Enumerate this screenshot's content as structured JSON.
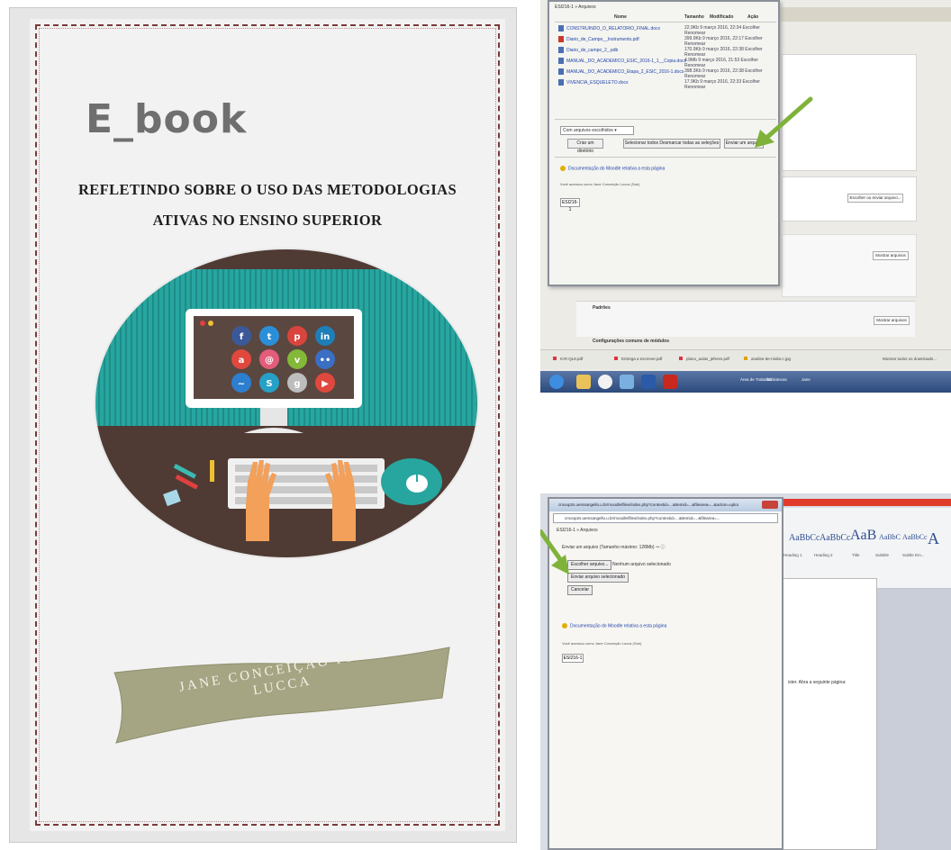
{
  "cover": {
    "title": "E_book",
    "subtitle_line1": "REFLETINDO SOBRE O USO DAS METODOLOGIAS",
    "subtitle_line2": "ATIVAS NO ENSINO SUPERIOR",
    "author_line1": "JANE CONCEIÇÃO FERR",
    "author_line2": "LUCCA"
  },
  "screenshot1": {
    "dialog_title": "ESI216-1 » Arquivos",
    "columns": {
      "name": "Nome",
      "size": "Tamanho",
      "modified": "Modificado",
      "action": "Ação"
    },
    "files": [
      {
        "name": "CONSTRUINDO_O_RELATORIO_FINAL.docx",
        "meta": "22.9Kb 9 março 2016, 22:34 Escolher Renomear"
      },
      {
        "name": "Diario_de_Campo__Instrumento.pdf",
        "meta": "399.9Kb 9 março 2016, 22:17 Escolher Renomear"
      },
      {
        "name": "Diario_de_campo_2_.pdb",
        "meta": "170.9Kb 9 março 2016, 22:38 Escolher Renomear"
      },
      {
        "name": "MANUAL_DO_ACADEMICO_ESIC_2016-1_1__Copia.docx",
        "meta": "4.9Mb 9 março 2016, 21:53 Escolher Renomear"
      },
      {
        "name": "MANUAL_DO_ACADEMICO_Etapa_2_ESIC_2016-1.docx",
        "meta": "398.3Kb 9 março 2016, 22:38 Escolher Renomear"
      },
      {
        "name": "VIVENCIA_ESQUELETO.docx",
        "meta": "17.9Kb 9 março 2016, 22:33 Escolher Renomear"
      }
    ],
    "select_value": "Com arquivos escolhidos",
    "create_folder_button": "Criar um diretório",
    "select_all_button": "Selecionar todos  Desmarcar todas as seleções",
    "send_file_button": "Enviar um arquivo",
    "moodle_doc_link": "Documentação do Moodle relativa a esta página",
    "login_text": "Você acessou como Jane Conceição Lucca (Sair)",
    "course_link": "ESI216-1",
    "choose_file_button": "Escolher ou enviar arquivo...",
    "show_files_button": "Mostrar arquivos",
    "show_files_button2": "Mostrar arquivos",
    "settings_text": "Configuração",
    "patterns_label": "Padrões",
    "module_settings_label": "Configurações comuns de módulos",
    "tabs": [
      "ICR-QL8.pdf",
      "Entrega a escrever.pdf",
      "plano_aulas_jeferes.pdf",
      "analise-de-midia-c.jpg"
    ],
    "show_all_downloads": "Mostrar todos os downloads...",
    "taskbar": {
      "item1": "Área de Trabalho",
      "item2": "Bibliotecas",
      "item3": "Jane"
    }
  },
  "screenshot2": {
    "window_title": "cmoop2s.uemsangello.u.br/moodle/files/index.php?contextid=...&itemid=...&filearea=...&action=upload",
    "address": "cmoop2s.uemsangello.u.br/moodle/files/index.php?contextid=...&itemid=...&filearea=...",
    "breadcrumb": "ESI216-1 » Arquivos",
    "upload_label": "Enviar um arquivo (Tamanho máximo: 128Mb) ⇒ ⓘ",
    "choose_file_button": "Escolher arquivo...",
    "no_file_text": "Nenhum arquivo selecionado",
    "send_button": "Enviar arquivo selecionado",
    "cancel_button": "Cancelar",
    "moodle_doc_link": "Documentação do Moodle relativa a esta página",
    "login_text": "Você acessou como Jane Conceição Lucca (Sair)",
    "course_link": "ESI216-1",
    "ribbon_styles": [
      "AaBbCc",
      "AaBbCc",
      "AaB",
      "AaBbC",
      "AaBbCc"
    ],
    "ribbon_labels": [
      "Heading 1",
      "Heading 2",
      "Title",
      "Subtitle",
      "Subtle Em..."
    ],
    "page_text": "ister. Abra a seguinte página:"
  },
  "colors": {
    "teal": "#27a6a0",
    "dark_brown": "#4f3b34",
    "ribbon": "#a5a584",
    "green_arrow": "#7fb23b",
    "link_blue": "#2244aa"
  }
}
